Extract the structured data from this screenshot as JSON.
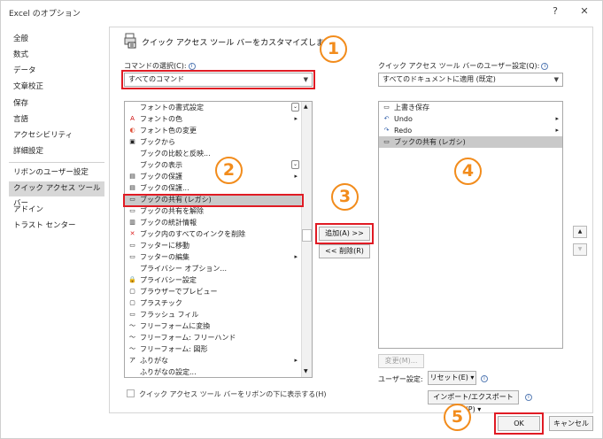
{
  "window": {
    "title": "Excel のオプション",
    "help_button": "?",
    "close_button": "✕"
  },
  "sidebar": {
    "items": [
      {
        "label": "全般"
      },
      {
        "label": "数式"
      },
      {
        "label": "データ"
      },
      {
        "label": "文章校正"
      },
      {
        "label": "保存"
      },
      {
        "label": "言語"
      },
      {
        "label": "アクセシビリティ"
      },
      {
        "label": "詳細設定"
      },
      {
        "label": "リボンのユーザー設定"
      },
      {
        "label": "クイック アクセス ツール バー"
      },
      {
        "label": "アドイン"
      },
      {
        "label": "トラスト センター"
      }
    ],
    "selected": "クイック アクセス ツール バー"
  },
  "main": {
    "heading": "クイック アクセス ツール バーをカスタマイズします。",
    "choose_label": "コマンドの選択(C):",
    "choose_value": "すべてのコマンド",
    "customize_label": "クイック アクセス ツール バーのユーザー設定(Q):",
    "customize_value": "すべてのドキュメントに適用 (既定)",
    "commands": [
      {
        "icon": "",
        "label": "フォントの書式設定",
        "sub": "mini"
      },
      {
        "icon": "A",
        "label": "フォントの色",
        "sub": "▸"
      },
      {
        "icon": "◐",
        "label": "フォント色の変更",
        "sub": ""
      },
      {
        "icon": "▣",
        "label": "ブックから",
        "sub": ""
      },
      {
        "icon": "",
        "label": "ブックの比較と反映...",
        "sub": ""
      },
      {
        "icon": "",
        "label": "ブックの表示",
        "sub": "mini"
      },
      {
        "icon": "▤",
        "label": "ブックの保護",
        "sub": "▸"
      },
      {
        "icon": "▤",
        "label": "ブックの保護...",
        "sub": ""
      },
      {
        "icon": "▭",
        "label": "ブックの共有 (レガシ)",
        "sub": ""
      },
      {
        "icon": "▭",
        "label": "ブックの共有を解除",
        "sub": ""
      },
      {
        "icon": "▥",
        "label": "ブックの統計情報",
        "sub": ""
      },
      {
        "icon": "✕",
        "label": "ブック内のすべてのインクを削除",
        "sub": ""
      },
      {
        "icon": "▭",
        "label": "フッターに移動",
        "sub": ""
      },
      {
        "icon": "▭",
        "label": "フッターの編集",
        "sub": "▸"
      },
      {
        "icon": "",
        "label": "プライバシー オプション...",
        "sub": ""
      },
      {
        "icon": "🔒",
        "label": "プライバシー設定",
        "sub": ""
      },
      {
        "icon": "▢",
        "label": "ブラウザーでプレビュー",
        "sub": ""
      },
      {
        "icon": "▢",
        "label": "プラスチック",
        "sub": ""
      },
      {
        "icon": "▭",
        "label": "フラッシュ フィル",
        "sub": ""
      },
      {
        "icon": "〜",
        "label": "フリーフォームに変換",
        "sub": ""
      },
      {
        "icon": "〜",
        "label": "フリーフォーム: フリーハンド",
        "sub": ""
      },
      {
        "icon": "〜",
        "label": "フリーフォーム: 図形",
        "sub": ""
      },
      {
        "icon": "ア",
        "label": "ふりがな",
        "sub": "▸"
      },
      {
        "icon": "",
        "label": "ふりがなの設定...",
        "sub": ""
      }
    ],
    "selected_command": "ブックの共有 (レガシ)",
    "toolbar_items": [
      {
        "icon": "▭",
        "label": "上書き保存",
        "sub": ""
      },
      {
        "icon": "↶",
        "label": "Undo",
        "sub": "▸"
      },
      {
        "icon": "↷",
        "label": "Redo",
        "sub": "▸"
      },
      {
        "icon": "▭",
        "label": "ブックの共有 (レガシ)",
        "sub": ""
      }
    ],
    "add_button": "追加(A) >>",
    "remove_button": "<< 削除(R)",
    "modify_button": "変更(M)...",
    "reset_label": "ユーザー設定:",
    "reset_button": "リセット(E) ▾",
    "import_export_button": "インポート/エクスポート(P) ▾",
    "show_below_checkbox": "クイック アクセス ツール バーをリボンの下に表示する(H)",
    "move_up": "▲",
    "move_down": "▼"
  },
  "footer": {
    "ok_button": "OK",
    "cancel_button": "キャンセル"
  },
  "annotations": {
    "badges": [
      "1",
      "2",
      "3",
      "4",
      "5"
    ],
    "accent_color": "#f28c1c",
    "highlight_color": "#e01b24"
  }
}
